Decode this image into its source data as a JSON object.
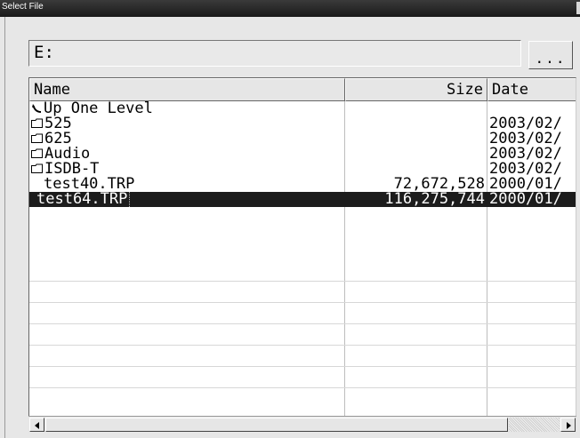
{
  "window": {
    "title": "Select File"
  },
  "path_field": {
    "value": "E:"
  },
  "browse_button": {
    "label": "..."
  },
  "file_list": {
    "columns": {
      "name": "Name",
      "size": "Size",
      "date": "Date"
    },
    "rows": [
      {
        "name": "Up One Level",
        "size": "",
        "date": "",
        "icon": "up-arrow-icon"
      },
      {
        "name": "525",
        "size": "",
        "date": "2003/02/",
        "icon": "folder-icon"
      },
      {
        "name": "625",
        "size": "",
        "date": "2003/02/",
        "icon": "folder-icon"
      },
      {
        "name": "Audio",
        "size": "",
        "date": "2003/02/",
        "icon": "folder-icon"
      },
      {
        "name": "ISDB-T",
        "size": "",
        "date": "2003/02/",
        "icon": "folder-icon"
      },
      {
        "name": "test40.TRP",
        "size": "72,672,528",
        "date": "2000/01/",
        "icon": ""
      },
      {
        "name": "test64.TRP",
        "size": "116,275,744",
        "date": "2000/01/",
        "icon": "",
        "selected": true
      }
    ]
  },
  "colors": {
    "selection_bg": "#1c1c1c",
    "title_bar": "#262626",
    "window_bg": "#e7e7e7"
  }
}
